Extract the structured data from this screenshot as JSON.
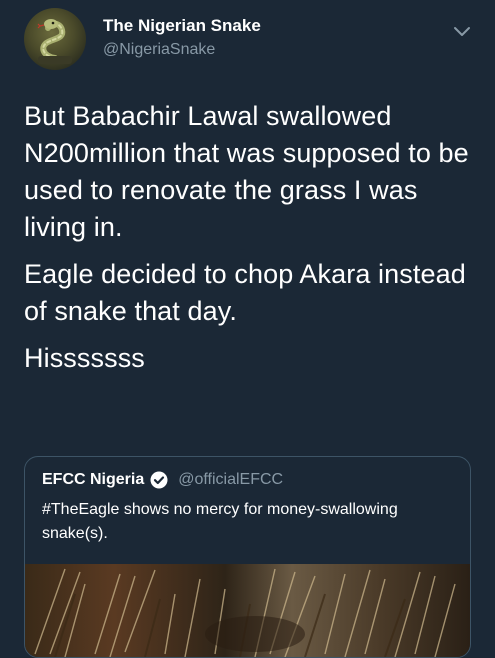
{
  "tweet": {
    "display_name": "The Nigerian Snake",
    "handle": "@NigeriaSnake",
    "paragraphs": [
      "But Babachir Lawal swallowed N200million that was supposed to be used to renovate the grass I was living in.",
      "Eagle decided to chop Akara instead of snake that day.",
      "Hisssssss"
    ]
  },
  "quoted_tweet": {
    "display_name": "EFCC Nigeria",
    "handle": "@officialEFCC",
    "text": "#TheEagle shows no mercy for money-swallowing snake(s)."
  },
  "colors": {
    "background": "#1b2836",
    "secondary_text": "#8899a6",
    "verified_badge": "#ffffff"
  },
  "icons": {
    "more": "chevron-down-icon",
    "verified": "verified-badge-icon"
  }
}
